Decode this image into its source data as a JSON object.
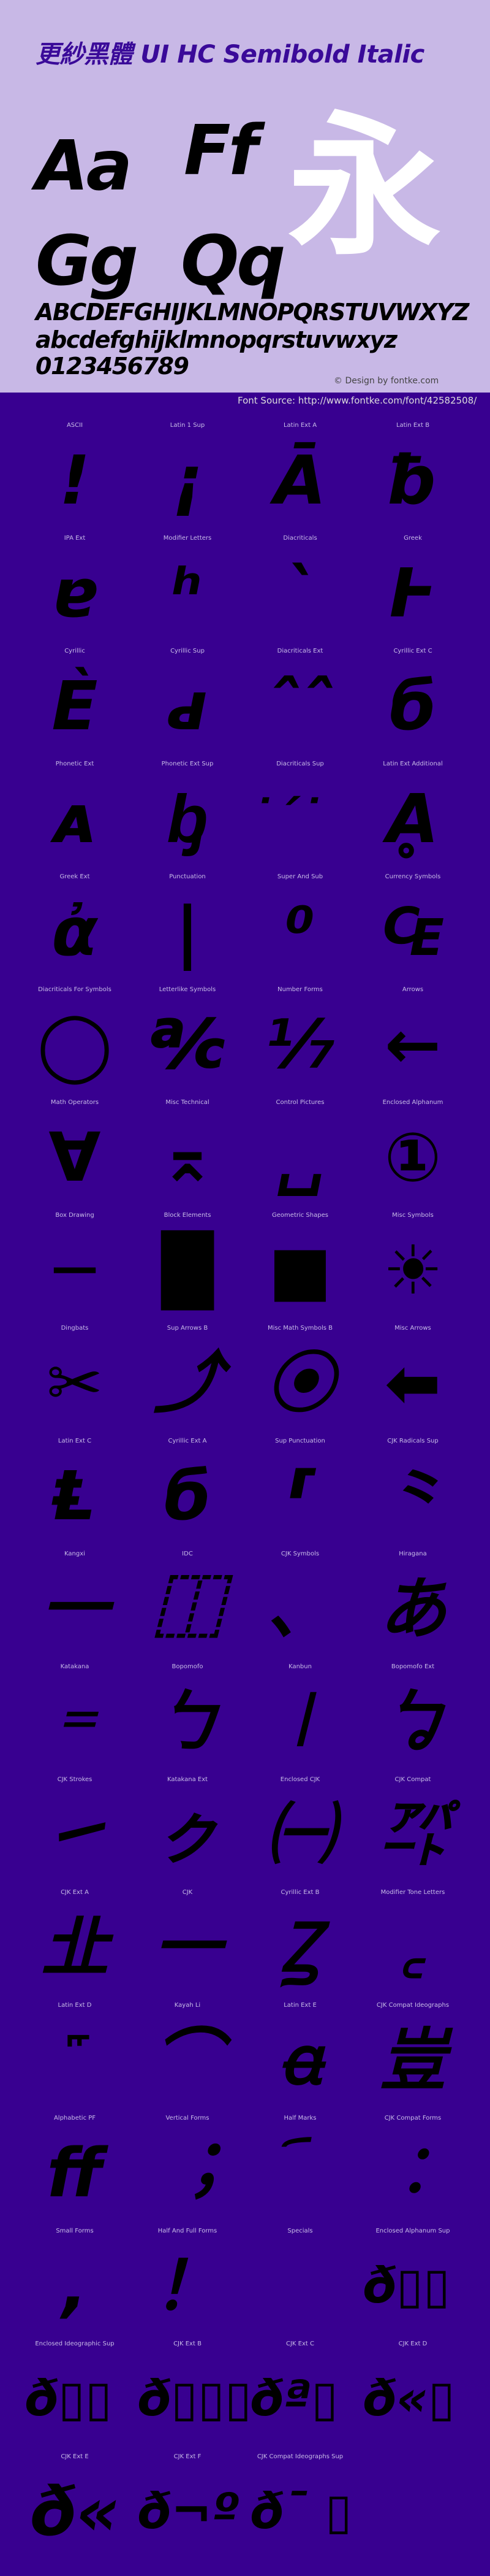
{
  "header": {
    "title": "更紗黑體 UI HC Semibold Italic",
    "samples": [
      "Aa",
      "Ff",
      "Gg",
      "Qq"
    ],
    "kanji": "永",
    "uppercase": "ABCDEFGHIJKLMNOPQRSTUVWXYZ",
    "lowercase": "abcdefghijklmnopqrstuvwxyz",
    "digits": "0123456789",
    "credit": "© Design by fontke.com",
    "source": "Font Source: http://www.fontke.com/font/42582508/"
  },
  "colors": {
    "header_bg": "#c8b8e6",
    "body_bg": "#380090",
    "title": "#3a0a99",
    "kanji": "#ffffff"
  },
  "cells": [
    {
      "label": "ASCII",
      "glyph": "!"
    },
    {
      "label": "Latin 1 Sup",
      "glyph": "¡"
    },
    {
      "label": "Latin Ext A",
      "glyph": "Ā"
    },
    {
      "label": "Latin Ext B",
      "glyph": "ƀ"
    },
    {
      "label": "IPA Ext",
      "glyph": "ɐ"
    },
    {
      "label": "Modifier Letters",
      "glyph": "ʰ"
    },
    {
      "label": "Diacriticals",
      "glyph": "`"
    },
    {
      "label": "Greek",
      "glyph": "Ͱ"
    },
    {
      "label": "Cyrillic",
      "glyph": "Ѐ"
    },
    {
      "label": "Cyrillic Sup",
      "glyph": "ԁ"
    },
    {
      "label": "Diacriticals Ext",
      "glyph": "ˆˆ"
    },
    {
      "label": "Cyrillic Ext C",
      "glyph": "б"
    },
    {
      "label": "Phonetic Ext",
      "glyph": "ᴀ"
    },
    {
      "label": "Phonetic Ext Sup",
      "glyph": "ᶀ"
    },
    {
      "label": "Diacriticals Sup",
      "glyph": "˙ˊ˙"
    },
    {
      "label": "Latin Ext Additional",
      "glyph": "Ḁ"
    },
    {
      "label": "Greek Ext",
      "glyph": "ἀ"
    },
    {
      "label": "Punctuation",
      "glyph": "|"
    },
    {
      "label": "Super And Sub",
      "glyph": "⁰"
    },
    {
      "label": "Currency Symbols",
      "glyph": "₠"
    },
    {
      "label": "Diacriticals For Symbols",
      "glyph": "◯"
    },
    {
      "label": "Letterlike Symbols",
      "glyph": "℀"
    },
    {
      "label": "Number Forms",
      "glyph": "⅐"
    },
    {
      "label": "Arrows",
      "glyph": "←"
    },
    {
      "label": "Math Operators",
      "glyph": "∀"
    },
    {
      "label": "Misc Technical",
      "glyph": "⌅"
    },
    {
      "label": "Control Pictures",
      "glyph": "␣"
    },
    {
      "label": "Enclosed Alphanum",
      "glyph": "①"
    },
    {
      "label": "Box Drawing",
      "glyph": "─"
    },
    {
      "label": "Block Elements",
      "glyph": "█"
    },
    {
      "label": "Geometric Shapes",
      "glyph": "■"
    },
    {
      "label": "Misc Symbols",
      "glyph": "☀"
    },
    {
      "label": "Dingbats",
      "glyph": "✂"
    },
    {
      "label": "Sup Arrows B",
      "glyph": "⤴"
    },
    {
      "label": "Misc Math Symbols B",
      "glyph": "⦿"
    },
    {
      "label": "Misc Arrows",
      "glyph": "⬅"
    },
    {
      "label": "Latin Ext C",
      "glyph": "Ⱡ"
    },
    {
      "label": "Cyrillic Ext A",
      "glyph": "б"
    },
    {
      "label": "Sup Punctuation",
      "glyph": "⸢"
    },
    {
      "label": "CJK Radicals Sup",
      "glyph": "⺀"
    },
    {
      "label": "Kangxi",
      "glyph": "⼀"
    },
    {
      "label": "IDC",
      "glyph": "⿰"
    },
    {
      "label": "CJK Symbols",
      "glyph": "、"
    },
    {
      "label": "Hiragana",
      "glyph": "あ"
    },
    {
      "label": "Katakana",
      "glyph": "゠"
    },
    {
      "label": "Bopomofo",
      "glyph": "ㄅ"
    },
    {
      "label": "Kanbun",
      "glyph": "㆐"
    },
    {
      "label": "Bopomofo Ext",
      "glyph": "ㆠ"
    },
    {
      "label": "CJK Strokes",
      "glyph": "㇀"
    },
    {
      "label": "Katakana Ext",
      "glyph": "ㇰ"
    },
    {
      "label": "Enclosed CJK",
      "glyph": "㈠"
    },
    {
      "label": "CJK Compat",
      "glyph": "㌀"
    },
    {
      "label": "CJK Ext A",
      "glyph": "㐀"
    },
    {
      "label": "CJK",
      "glyph": "一"
    },
    {
      "label": "Cyrillic Ext B",
      "glyph": "Ꙁ"
    },
    {
      "label": "Modifier Tone Letters",
      "glyph": "꜀"
    },
    {
      "label": "Latin Ext D",
      "glyph": "꜠"
    },
    {
      "label": "Kayah Li",
      "glyph": "⌒"
    },
    {
      "label": "Latin Ext E",
      "glyph": "ꬰ"
    },
    {
      "label": "CJK Compat Ideographs",
      "glyph": "豈"
    },
    {
      "label": "Alphabetic PF",
      "glyph": "ﬀ"
    },
    {
      "label": "Vertical Forms",
      "glyph": "︔"
    },
    {
      "label": "Half Marks",
      "glyph": "︠"
    },
    {
      "label": "CJK Compat Forms",
      "glyph": "︰"
    },
    {
      "label": "Small Forms",
      "glyph": ","
    },
    {
      "label": "Half And Full Forms",
      "glyph": "！"
    },
    {
      "label": "Specials",
      "glyph": "￼"
    },
    {
      "label": "Enclosed Alphanum Sup",
      "glyph": "ð▯▯"
    },
    {
      "label": "Enclosed Ideographic Sup",
      "glyph": "ð▯▯"
    },
    {
      "label": "CJK Ext B",
      "glyph": "ð▯▯▯"
    },
    {
      "label": "CJK Ext C",
      "glyph": "ðª▯"
    },
    {
      "label": "CJK Ext D",
      "glyph": "ð«▯"
    },
    {
      "label": "CJK Ext E",
      "glyph": "ð«"
    },
    {
      "label": "CJK Ext F",
      "glyph": "ð¬º"
    },
    {
      "label": "CJK Compat Ideographs Sup",
      "glyph": "ð¯ ▯"
    }
  ]
}
